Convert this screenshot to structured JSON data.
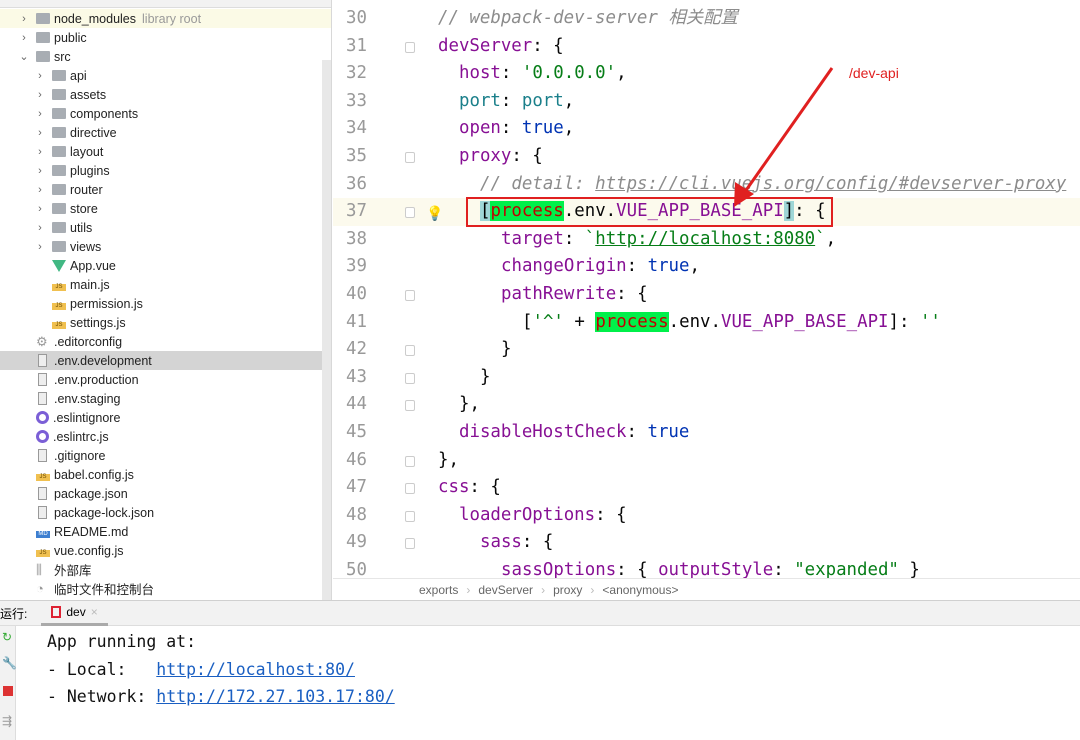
{
  "tree": [
    {
      "label": "node_modules",
      "extra": "library root",
      "icon": "folder",
      "depth": 1,
      "chev": ">",
      "lib": true
    },
    {
      "label": "public",
      "icon": "folder",
      "depth": 1,
      "chev": ">"
    },
    {
      "label": "src",
      "icon": "folder",
      "depth": 1,
      "chev": "v"
    },
    {
      "label": "api",
      "icon": "folder",
      "depth": 2,
      "chev": ">"
    },
    {
      "label": "assets",
      "icon": "folder",
      "depth": 2,
      "chev": ">"
    },
    {
      "label": "components",
      "icon": "folder",
      "depth": 2,
      "chev": ">"
    },
    {
      "label": "directive",
      "icon": "folder",
      "depth": 2,
      "chev": ">"
    },
    {
      "label": "layout",
      "icon": "folder",
      "depth": 2,
      "chev": ">"
    },
    {
      "label": "plugins",
      "icon": "folder",
      "depth": 2,
      "chev": ">"
    },
    {
      "label": "router",
      "icon": "folder",
      "depth": 2,
      "chev": ">"
    },
    {
      "label": "store",
      "icon": "folder",
      "depth": 2,
      "chev": ">"
    },
    {
      "label": "utils",
      "icon": "folder",
      "depth": 2,
      "chev": ">"
    },
    {
      "label": "views",
      "icon": "folder",
      "depth": 2,
      "chev": ">"
    },
    {
      "label": "App.vue",
      "icon": "vue",
      "depth": 2
    },
    {
      "label": "main.js",
      "icon": "js",
      "depth": 2
    },
    {
      "label": "permission.js",
      "icon": "js",
      "depth": 2
    },
    {
      "label": "settings.js",
      "icon": "js",
      "depth": 2
    },
    {
      "label": ".editorconfig",
      "icon": "gear",
      "depth": 1
    },
    {
      "label": ".env.development",
      "icon": "file",
      "depth": 1,
      "selected": true
    },
    {
      "label": ".env.production",
      "icon": "file",
      "depth": 1
    },
    {
      "label": ".env.staging",
      "icon": "file",
      "depth": 1
    },
    {
      "label": ".eslintignore",
      "icon": "eslint",
      "depth": 1
    },
    {
      "label": ".eslintrc.js",
      "icon": "eslint",
      "depth": 1
    },
    {
      "label": ".gitignore",
      "icon": "file",
      "depth": 1
    },
    {
      "label": "babel.config.js",
      "icon": "js",
      "depth": 1
    },
    {
      "label": "package.json",
      "icon": "file",
      "depth": 1
    },
    {
      "label": "package-lock.json",
      "icon": "file",
      "depth": 1
    },
    {
      "label": "README.md",
      "icon": "md",
      "depth": 1
    },
    {
      "label": "vue.config.js",
      "icon": "js",
      "depth": 1
    },
    {
      "label": "外部库",
      "icon": "library",
      "depth": 0
    },
    {
      "label": "临时文件和控制台",
      "icon": "scratch",
      "depth": 0
    }
  ],
  "code": [
    {
      "n": "30",
      "indent": 0,
      "tokens": [
        [
          "// webpack-dev-server 相关配置",
          "c"
        ]
      ]
    },
    {
      "n": "31",
      "indent": 0,
      "fold": true,
      "tokens": [
        [
          "devServer",
          "k"
        ],
        [
          ": {",
          "t"
        ]
      ]
    },
    {
      "n": "32",
      "indent": 1,
      "tokens": [
        [
          "host",
          "k"
        ],
        [
          ": ",
          "t"
        ],
        [
          "'0.0.0.0'",
          "s"
        ],
        [
          ",",
          "t"
        ]
      ]
    },
    {
      "n": "33",
      "indent": 1,
      "tokens": [
        [
          "port",
          "p"
        ],
        [
          ": ",
          "t"
        ],
        [
          "port",
          "p"
        ],
        [
          ",",
          "t"
        ]
      ]
    },
    {
      "n": "34",
      "indent": 1,
      "tokens": [
        [
          "open",
          "k"
        ],
        [
          ": ",
          "t"
        ],
        [
          "true",
          "b"
        ],
        [
          ",",
          "t"
        ]
      ]
    },
    {
      "n": "35",
      "indent": 1,
      "fold": true,
      "tokens": [
        [
          "proxy",
          "k"
        ],
        [
          ": {",
          "t"
        ]
      ]
    },
    {
      "n": "36",
      "indent": 2,
      "tokens": [
        [
          "// detail: ",
          "c"
        ],
        [
          "https://cli.vuejs.org/config/#devserver-proxy",
          "cu"
        ]
      ]
    },
    {
      "n": "37",
      "indent": 2,
      "fold": true,
      "bulb": true,
      "current": true,
      "tokens": [
        [
          "[",
          "br"
        ],
        [
          "process",
          "hl"
        ],
        [
          ".env.",
          "t"
        ],
        [
          "VUE_APP_BASE_API",
          "k"
        ],
        [
          "]",
          "br"
        ],
        [
          ": {",
          "t"
        ]
      ]
    },
    {
      "n": "38",
      "indent": 3,
      "tokens": [
        [
          "target",
          "k"
        ],
        [
          ": ",
          "t"
        ],
        [
          "`",
          "s"
        ],
        [
          "http://localhost:8080",
          "u"
        ],
        [
          "`",
          "s"
        ],
        [
          ",",
          "t"
        ]
      ]
    },
    {
      "n": "39",
      "indent": 3,
      "tokens": [
        [
          "changeOrigin",
          "k"
        ],
        [
          ": ",
          "t"
        ],
        [
          "true",
          "b"
        ],
        [
          ",",
          "t"
        ]
      ]
    },
    {
      "n": "40",
      "indent": 3,
      "fold": true,
      "tokens": [
        [
          "pathRewrite",
          "k"
        ],
        [
          ": {",
          "t"
        ]
      ]
    },
    {
      "n": "41",
      "indent": 4,
      "tokens": [
        [
          "[",
          "t"
        ],
        [
          "'^'",
          "s"
        ],
        [
          " + ",
          "t"
        ],
        [
          "process",
          "hl"
        ],
        [
          ".env.",
          "t"
        ],
        [
          "VUE_APP_BASE_API",
          "k"
        ],
        [
          "]: ",
          "t"
        ],
        [
          "''",
          "s"
        ]
      ]
    },
    {
      "n": "42",
      "indent": 3,
      "fold": true,
      "tokens": [
        [
          "}",
          "t"
        ]
      ]
    },
    {
      "n": "43",
      "indent": 2,
      "fold": true,
      "tokens": [
        [
          "}",
          "t"
        ]
      ]
    },
    {
      "n": "44",
      "indent": 1,
      "fold": true,
      "tokens": [
        [
          "},",
          "t"
        ]
      ]
    },
    {
      "n": "45",
      "indent": 1,
      "tokens": [
        [
          "disableHostCheck",
          "k"
        ],
        [
          ": ",
          "t"
        ],
        [
          "true",
          "b"
        ]
      ]
    },
    {
      "n": "46",
      "indent": 0,
      "fold": true,
      "tokens": [
        [
          "},",
          "t"
        ]
      ]
    },
    {
      "n": "47",
      "indent": 0,
      "fold": true,
      "tokens": [
        [
          "css",
          "k"
        ],
        [
          ": {",
          "t"
        ]
      ]
    },
    {
      "n": "48",
      "indent": 1,
      "fold": true,
      "tokens": [
        [
          "loaderOptions",
          "k"
        ],
        [
          ": {",
          "t"
        ]
      ]
    },
    {
      "n": "49",
      "indent": 2,
      "fold": true,
      "tokens": [
        [
          "sass",
          "k"
        ],
        [
          ": {",
          "t"
        ]
      ]
    },
    {
      "n": "50",
      "indent": 3,
      "tokens": [
        [
          "sassOptions",
          "k"
        ],
        [
          ": { ",
          "t"
        ],
        [
          "outputStyle",
          "k"
        ],
        [
          ": ",
          "t"
        ],
        [
          "\"expanded\"",
          "s"
        ],
        [
          " }",
          "t"
        ]
      ]
    }
  ],
  "annotation": "/dev-api",
  "breadcrumb": [
    "exports",
    "devServer",
    "proxy",
    "<anonymous>"
  ],
  "run": {
    "label": "运行:",
    "tab": "dev",
    "close": "×"
  },
  "console": {
    "line1": "App running at:",
    "local_label": "- Local:   ",
    "local_url": "http://localhost:80/",
    "network_label": "- Network: ",
    "network_url": "http://172.27.103.17:80/"
  }
}
